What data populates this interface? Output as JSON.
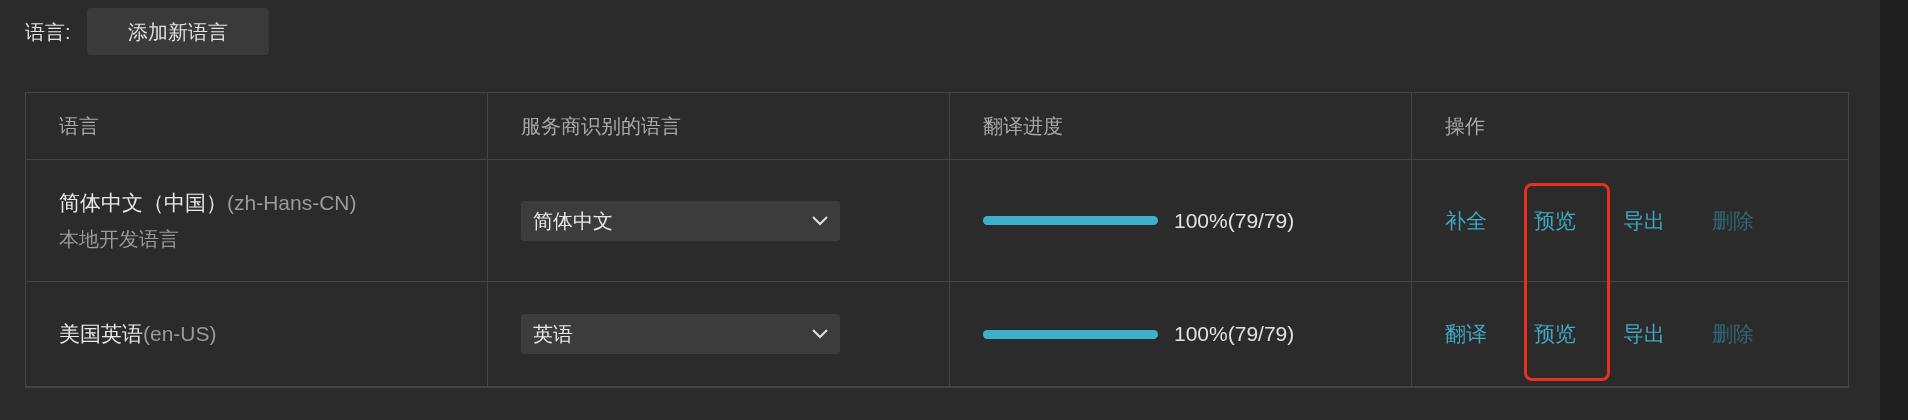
{
  "toolbar": {
    "label": "语言:",
    "add_button": "添加新语言"
  },
  "table": {
    "columns": [
      "语言",
      "服务商识别的语言",
      "翻译进度",
      "操作"
    ],
    "rows": [
      {
        "name": "简体中文（中国）",
        "code": "(zh-Hans-CN)",
        "note": "本地开发语言",
        "provider_language": "简体中文",
        "level": 1,
        "progress": "100%(79/79)",
        "actions": [
          {
            "label": "补全",
            "disabled": false
          },
          {
            "label": "预览",
            "disabled": false
          },
          {
            "label": "导出",
            "disabled": false
          },
          {
            "label": "删除",
            "disabled": true
          }
        ]
      },
      {
        "name": "美国英语",
        "code": "(en-US)",
        "provider_language": "英语",
        "level": 1,
        "progress": "100%(79/79)",
        "actions": [
          {
            "label": "翻译",
            "disabled": false
          },
          {
            "label": "预览",
            "disabled": false
          },
          {
            "label": "导出",
            "disabled": false
          },
          {
            "label": "删除",
            "disabled": true
          }
        ]
      }
    ]
  }
}
